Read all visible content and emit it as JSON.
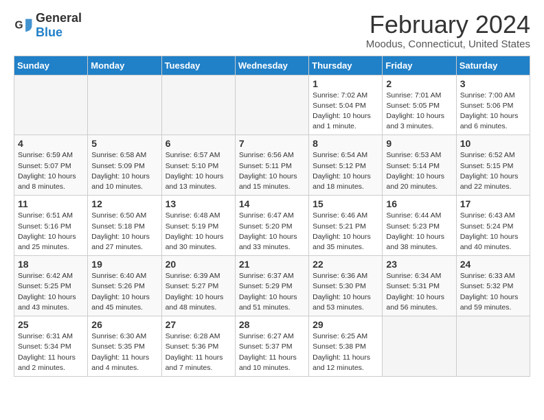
{
  "logo": {
    "text_general": "General",
    "text_blue": "Blue"
  },
  "header": {
    "title": "February 2024",
    "subtitle": "Moodus, Connecticut, United States"
  },
  "weekdays": [
    "Sunday",
    "Monday",
    "Tuesday",
    "Wednesday",
    "Thursday",
    "Friday",
    "Saturday"
  ],
  "weeks": [
    [
      {
        "day": "",
        "info": ""
      },
      {
        "day": "",
        "info": ""
      },
      {
        "day": "",
        "info": ""
      },
      {
        "day": "",
        "info": ""
      },
      {
        "day": "1",
        "info": "Sunrise: 7:02 AM\nSunset: 5:04 PM\nDaylight: 10 hours\nand 1 minute."
      },
      {
        "day": "2",
        "info": "Sunrise: 7:01 AM\nSunset: 5:05 PM\nDaylight: 10 hours\nand 3 minutes."
      },
      {
        "day": "3",
        "info": "Sunrise: 7:00 AM\nSunset: 5:06 PM\nDaylight: 10 hours\nand 6 minutes."
      }
    ],
    [
      {
        "day": "4",
        "info": "Sunrise: 6:59 AM\nSunset: 5:07 PM\nDaylight: 10 hours\nand 8 minutes."
      },
      {
        "day": "5",
        "info": "Sunrise: 6:58 AM\nSunset: 5:09 PM\nDaylight: 10 hours\nand 10 minutes."
      },
      {
        "day": "6",
        "info": "Sunrise: 6:57 AM\nSunset: 5:10 PM\nDaylight: 10 hours\nand 13 minutes."
      },
      {
        "day": "7",
        "info": "Sunrise: 6:56 AM\nSunset: 5:11 PM\nDaylight: 10 hours\nand 15 minutes."
      },
      {
        "day": "8",
        "info": "Sunrise: 6:54 AM\nSunset: 5:12 PM\nDaylight: 10 hours\nand 18 minutes."
      },
      {
        "day": "9",
        "info": "Sunrise: 6:53 AM\nSunset: 5:14 PM\nDaylight: 10 hours\nand 20 minutes."
      },
      {
        "day": "10",
        "info": "Sunrise: 6:52 AM\nSunset: 5:15 PM\nDaylight: 10 hours\nand 22 minutes."
      }
    ],
    [
      {
        "day": "11",
        "info": "Sunrise: 6:51 AM\nSunset: 5:16 PM\nDaylight: 10 hours\nand 25 minutes."
      },
      {
        "day": "12",
        "info": "Sunrise: 6:50 AM\nSunset: 5:18 PM\nDaylight: 10 hours\nand 27 minutes."
      },
      {
        "day": "13",
        "info": "Sunrise: 6:48 AM\nSunset: 5:19 PM\nDaylight: 10 hours\nand 30 minutes."
      },
      {
        "day": "14",
        "info": "Sunrise: 6:47 AM\nSunset: 5:20 PM\nDaylight: 10 hours\nand 33 minutes."
      },
      {
        "day": "15",
        "info": "Sunrise: 6:46 AM\nSunset: 5:21 PM\nDaylight: 10 hours\nand 35 minutes."
      },
      {
        "day": "16",
        "info": "Sunrise: 6:44 AM\nSunset: 5:23 PM\nDaylight: 10 hours\nand 38 minutes."
      },
      {
        "day": "17",
        "info": "Sunrise: 6:43 AM\nSunset: 5:24 PM\nDaylight: 10 hours\nand 40 minutes."
      }
    ],
    [
      {
        "day": "18",
        "info": "Sunrise: 6:42 AM\nSunset: 5:25 PM\nDaylight: 10 hours\nand 43 minutes."
      },
      {
        "day": "19",
        "info": "Sunrise: 6:40 AM\nSunset: 5:26 PM\nDaylight: 10 hours\nand 45 minutes."
      },
      {
        "day": "20",
        "info": "Sunrise: 6:39 AM\nSunset: 5:27 PM\nDaylight: 10 hours\nand 48 minutes."
      },
      {
        "day": "21",
        "info": "Sunrise: 6:37 AM\nSunset: 5:29 PM\nDaylight: 10 hours\nand 51 minutes."
      },
      {
        "day": "22",
        "info": "Sunrise: 6:36 AM\nSunset: 5:30 PM\nDaylight: 10 hours\nand 53 minutes."
      },
      {
        "day": "23",
        "info": "Sunrise: 6:34 AM\nSunset: 5:31 PM\nDaylight: 10 hours\nand 56 minutes."
      },
      {
        "day": "24",
        "info": "Sunrise: 6:33 AM\nSunset: 5:32 PM\nDaylight: 10 hours\nand 59 minutes."
      }
    ],
    [
      {
        "day": "25",
        "info": "Sunrise: 6:31 AM\nSunset: 5:34 PM\nDaylight: 11 hours\nand 2 minutes."
      },
      {
        "day": "26",
        "info": "Sunrise: 6:30 AM\nSunset: 5:35 PM\nDaylight: 11 hours\nand 4 minutes."
      },
      {
        "day": "27",
        "info": "Sunrise: 6:28 AM\nSunset: 5:36 PM\nDaylight: 11 hours\nand 7 minutes."
      },
      {
        "day": "28",
        "info": "Sunrise: 6:27 AM\nSunset: 5:37 PM\nDaylight: 11 hours\nand 10 minutes."
      },
      {
        "day": "29",
        "info": "Sunrise: 6:25 AM\nSunset: 5:38 PM\nDaylight: 11 hours\nand 12 minutes."
      },
      {
        "day": "",
        "info": ""
      },
      {
        "day": "",
        "info": ""
      }
    ]
  ]
}
